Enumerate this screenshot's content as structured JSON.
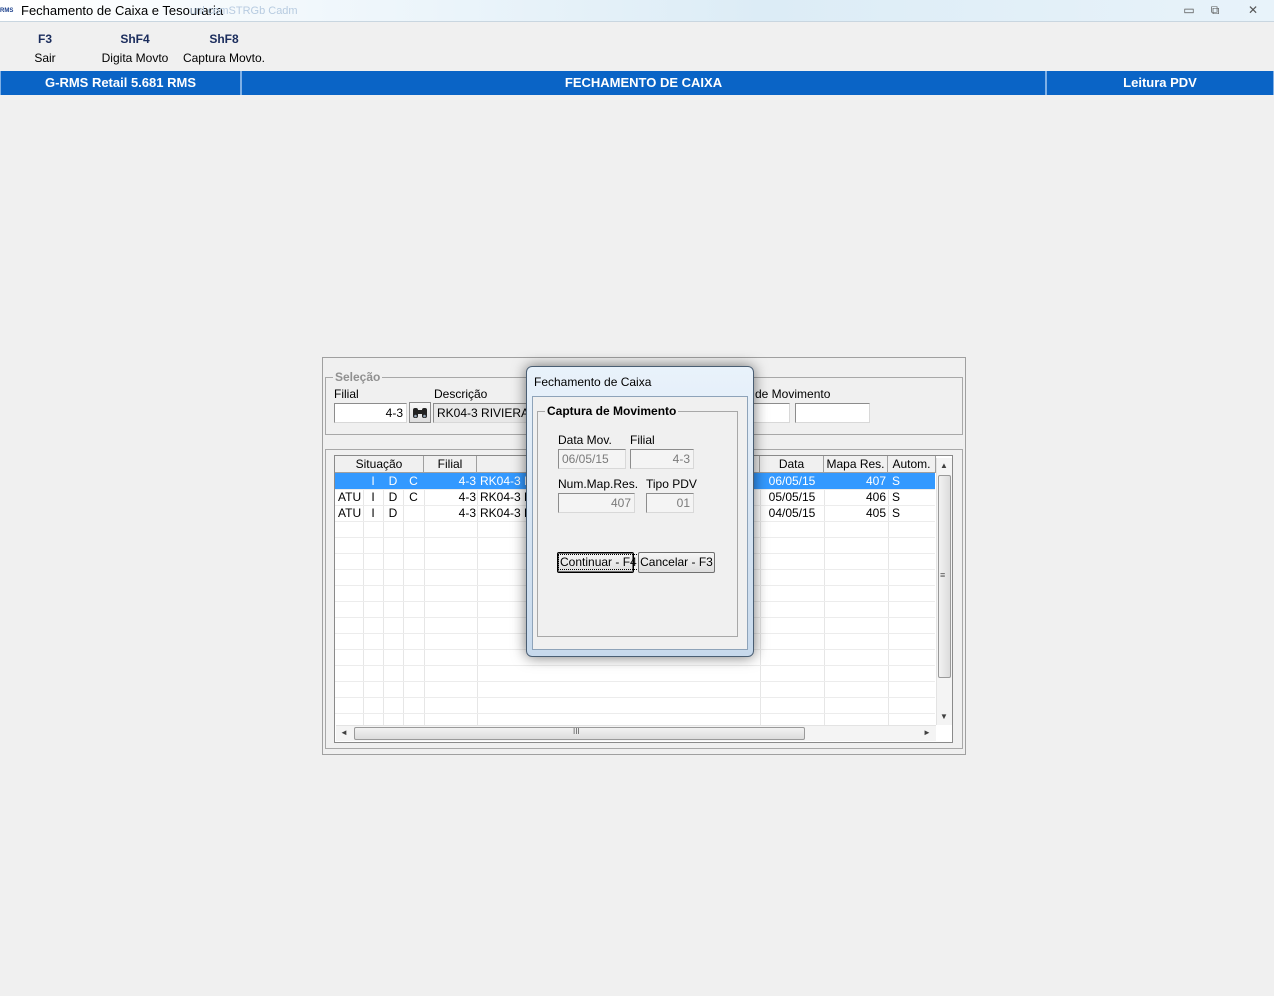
{
  "window": {
    "app_icon_text": "RMS",
    "title": "Fechamento de Caixa e Tesouraria",
    "ghost_title": "unl        comSTRGb   Cadm",
    "minimize": "▭",
    "restore": "⧉",
    "close": "✕"
  },
  "toolbar": {
    "items": [
      {
        "key": "F3",
        "label": "Sair"
      },
      {
        "key": "ShF4",
        "label": "Digita Movto"
      },
      {
        "key": "ShF8",
        "label": "Captura Movto."
      }
    ]
  },
  "header": {
    "left": "G-RMS Retail 5.681 RMS",
    "center": "FECHAMENTO DE CAIXA",
    "right": "Leitura PDV"
  },
  "selection": {
    "legend": "Seleção",
    "filial_label": "Filial",
    "filial_value": "4-3",
    "descricao_label": "Descrição",
    "descricao_value": "RK04-3 RIVIERA B",
    "movimento_label": "de Movimento",
    "movimento_from": "",
    "movimento_to": "",
    "search_icon": "binoculars-icon"
  },
  "grid": {
    "columns": [
      "Situação",
      "Filial",
      "Data",
      "Mapa Res.",
      "Autom."
    ],
    "rows": [
      {
        "sit1": "",
        "sit2": "I",
        "sit3": "D",
        "sit4": "C",
        "filial": "4-3",
        "desc": "RK04-3 R",
        "data": "06/05/15",
        "mapa": "407",
        "autom": "S",
        "selected": true
      },
      {
        "sit1": "ATU",
        "sit2": "I",
        "sit3": "D",
        "sit4": "C",
        "filial": "4-3",
        "desc": "RK04-3 R",
        "data": "05/05/15",
        "mapa": "406",
        "autom": "S",
        "selected": false
      },
      {
        "sit1": "ATU",
        "sit2": "I",
        "sit3": "D",
        "sit4": "",
        "filial": "4-3",
        "desc": "RK04-3 R",
        "data": "04/05/15",
        "mapa": "405",
        "autom": "S",
        "selected": false
      }
    ],
    "scroll_up": "▲",
    "scroll_down": "▼",
    "scroll_left": "◄",
    "scroll_right": "►",
    "grip": "≡",
    "hgrip": "III"
  },
  "dialog": {
    "title": "Fechamento de Caixa",
    "legend": "Captura de Movimento",
    "data_mov_label": "Data Mov.",
    "data_mov_value": "06/05/15",
    "filial_label": "Filial",
    "filial_value": "4-3",
    "num_map_label": "Num.Map.Res.",
    "num_map_value": "407",
    "tipo_pdv_label": "Tipo PDV",
    "tipo_pdv_value": "01",
    "continue_button": "Continuar - F4",
    "cancel_button": "Cancelar - F3"
  },
  "colors": {
    "header_blue": "#0a64c6",
    "selection_blue": "#3399ff",
    "background": "#f0f0f0"
  }
}
